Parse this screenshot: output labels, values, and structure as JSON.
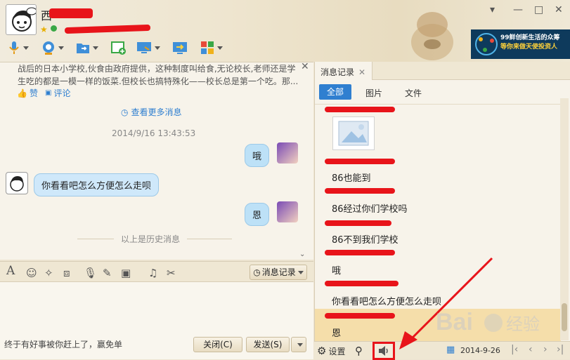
{
  "header": {
    "contact_name": "西",
    "controls": [
      "▾",
      "—",
      "□",
      "✕"
    ]
  },
  "chat": {
    "preview_text_line1": "战后的日本小学校,伙食由政府提供，这种制度叫给食,无论校长,老师还是学",
    "preview_text_line2": "生吃的都是一模一样的饭菜.但校长也搞特殊化——校长总是第一个吃。那...",
    "like_label": "赞",
    "comment_label": "评论",
    "more_messages": "查看更多消息",
    "timestamp": "2014/9/16 13:43:53",
    "messages": [
      {
        "from": "me",
        "text": "哦"
      },
      {
        "from": "other",
        "text": "你看看吧怎么方便怎么走呗"
      },
      {
        "from": "me",
        "text": "恩"
      }
    ],
    "history_divider": "以上是历史消息"
  },
  "input_toolbar": {
    "history_button": "消息记录",
    "icons": [
      "font-icon",
      "emoji-icon",
      "magic-icon",
      "capture-icon",
      "voice-icon",
      "edit-icon",
      "image-icon",
      "music-icon",
      "scissors-icon"
    ]
  },
  "input": {
    "status_text": "终于有好事被你赶上了，赢免单",
    "close_button": "关闭(C)",
    "send_button": "发送(S)"
  },
  "history": {
    "tab_title": "消息记录",
    "filters": [
      "全部",
      "图片",
      "文件"
    ],
    "items": [
      "86也能到",
      "86经过你们学校吗",
      "86不到我们学校",
      "哦",
      "你看看吧怎么方便怎么走呗",
      "恩"
    ],
    "settings_label": "设置",
    "date": "2014-9-26",
    "name_prefix": "西"
  },
  "ad": {
    "line1": "99鲜创新生活的众筹",
    "line2": "等你来做天使投资人"
  },
  "colors": {
    "accent_blue": "#2f7fd0",
    "highlight_red": "#e8141a",
    "selected_row": "#f5deaa"
  }
}
